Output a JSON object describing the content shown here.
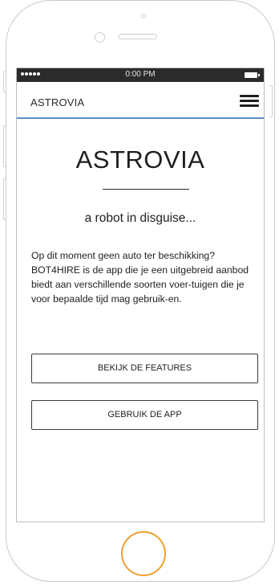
{
  "status_bar": {
    "time": "0:00 PM"
  },
  "navbar": {
    "title": "ASTROVIA"
  },
  "hero": {
    "title": "ASTROVIA",
    "tagline": "a robot in disguise..."
  },
  "description": "Op dit moment geen auto ter beschikking? BOT4HIRE is de app die je een uitgebreid aanbod biedt aan verschillende soorten voer-tuigen die je voor bepaalde tijd mag gebruik-en.",
  "buttons": {
    "features": "BEKIJK DE FEATURES",
    "app": "GEBRUIK DE APP"
  },
  "colors": {
    "accent_underline": "#5d8ec1",
    "home_button": "#f0a030",
    "status_bar_bg": "#2b2b2b"
  },
  "icons": {
    "menu": "hamburger-menu-icon",
    "battery": "battery-icon",
    "signal": "signal-dots-icon"
  }
}
